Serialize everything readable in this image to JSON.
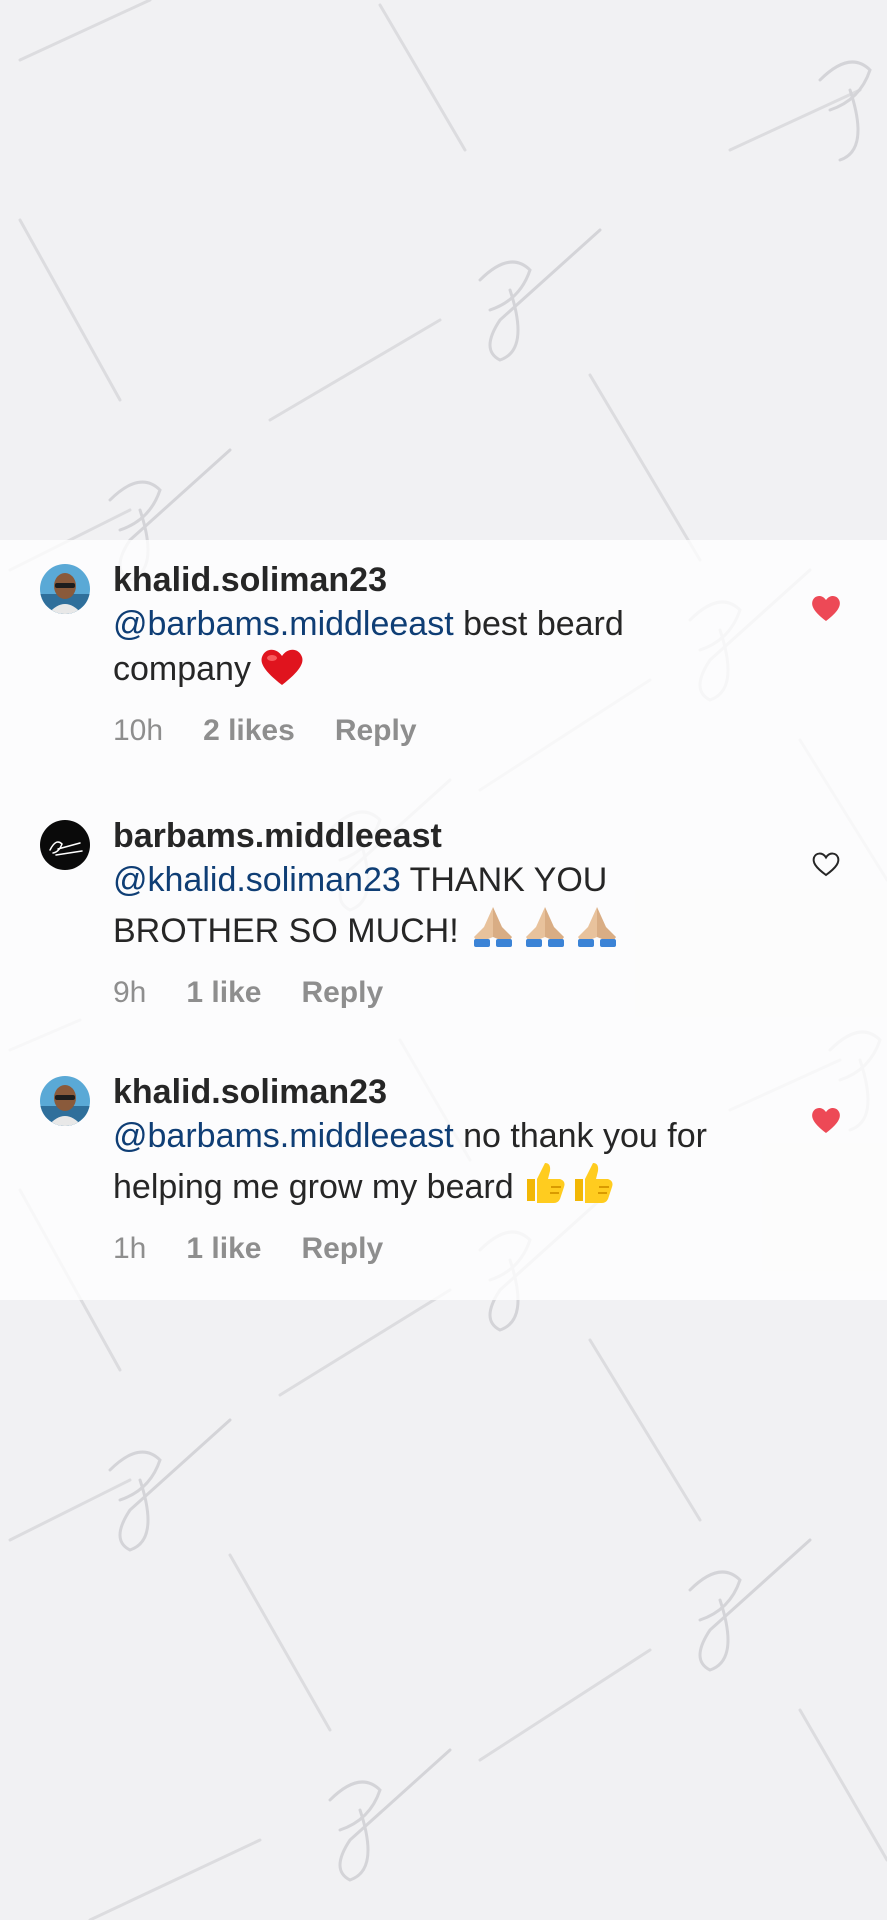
{
  "colors": {
    "mention": "#0f3e75",
    "meta": "#8e8e8e",
    "liked_heart": "#ed4956",
    "unliked_heart": "#262626"
  },
  "comments": [
    {
      "username": "khalid.soliman23",
      "mention": "@barbams.middleeast",
      "text": " best beard company",
      "text_line2": "company",
      "emojis": [
        "red-heart"
      ],
      "time": "10h",
      "likes": "2 likes",
      "reply": "Reply",
      "liked": true,
      "avatar": "person-avatar"
    },
    {
      "username": "barbams.middleeast",
      "mention": "@khalid.soliman23",
      "text": " THANK YOU BROTHER SO MUCH!",
      "emojis": [
        "folded-hands",
        "folded-hands",
        "folded-hands"
      ],
      "time": "9h",
      "likes": "1 like",
      "reply": "Reply",
      "liked": false,
      "avatar": "brand-logo-avatar"
    },
    {
      "username": "khalid.soliman23",
      "mention": "@barbams.middleeast",
      "text": " no thank you for helping me grow my beard",
      "emojis": [
        "thumbs-up",
        "thumbs-up"
      ],
      "time": "1h",
      "likes": "1 like",
      "reply": "Reply",
      "liked": true,
      "avatar": "person-avatar"
    }
  ]
}
